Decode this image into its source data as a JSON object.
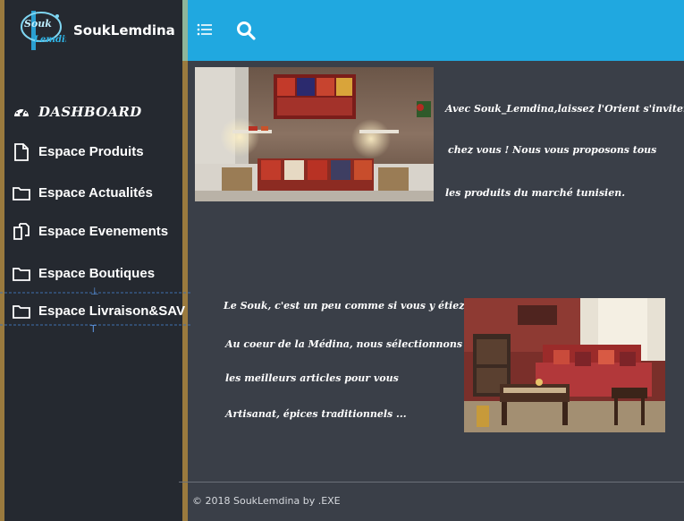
{
  "brand": {
    "name": "SoukLemdina",
    "logo_text": "Souk Lemdina"
  },
  "sidebar": {
    "items": [
      {
        "label": "DASHBOARD",
        "icon": "dashboard-icon"
      },
      {
        "label": "Espace Produits",
        "icon": "file-icon"
      },
      {
        "label": "Espace Actualités",
        "icon": "folder-icon"
      },
      {
        "label": "Espace Evenements",
        "icon": "copy-icon"
      },
      {
        "label": "Espace Boutiques",
        "icon": "folder-icon"
      },
      {
        "label": "Espace Livraison&SAV",
        "icon": "folder-icon"
      }
    ]
  },
  "header": {
    "menu_icon": "list-icon",
    "search_icon": "search-icon"
  },
  "main": {
    "intro_lines": [
      "Avec Souk_Lemdina,laissez l'Orient s'inviter",
      "chez vous ! Nous vous proposons tous",
      "les produits du marché tunisien."
    ],
    "souk_lines": [
      "Le Souk, c'est un peu comme si vous y étiez.",
      "Au coeur de la Médina, nous sélectionnons",
      "les meilleurs articles pour vous",
      "Artisanat, épices traditionnels ..."
    ]
  },
  "footer": {
    "text": "© 2018 SoukLemdina by .EXE"
  },
  "colors": {
    "header": "#20a8e0",
    "sidebar": "#252930",
    "content": "#3a3f48",
    "accent_border": "#9a7a3e"
  }
}
